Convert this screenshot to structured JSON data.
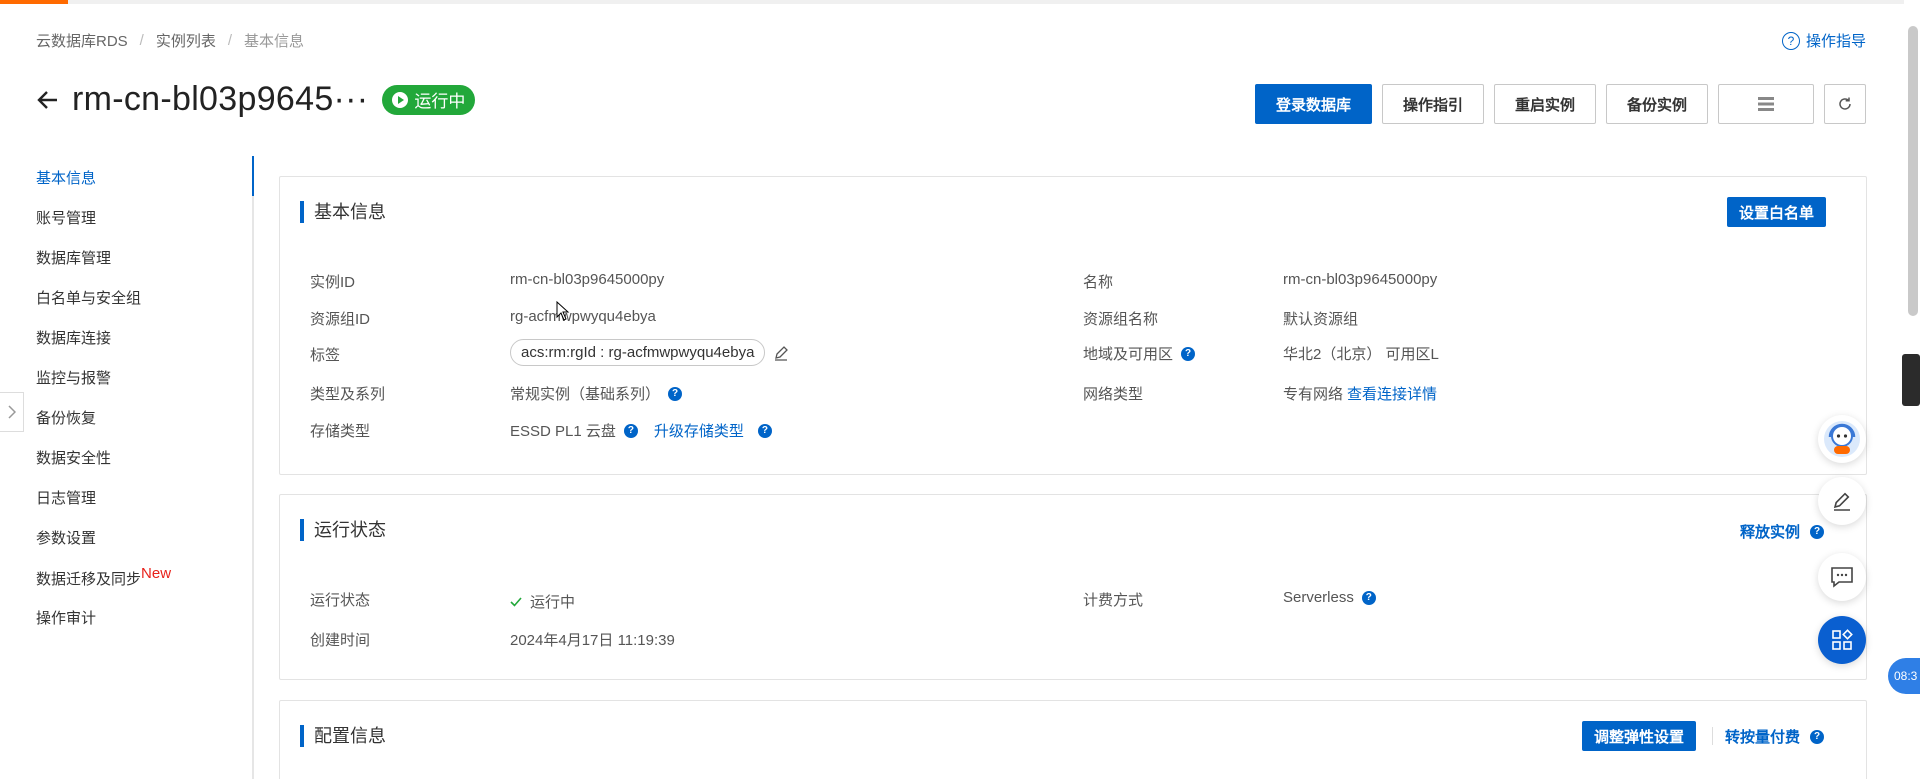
{
  "breadcrumb": [
    "云数据库RDS",
    "实例列表",
    "基本信息"
  ],
  "help_link": "操作指导",
  "title": "rm-cn-bl03p9645···",
  "status_badge": "运行中",
  "actions": {
    "login": "登录数据库",
    "guide": "操作指引",
    "restart": "重启实例",
    "backup": "备份实例"
  },
  "sidebar": {
    "items": [
      "基本信息",
      "账号管理",
      "数据库管理",
      "白名单与安全组",
      "数据库连接",
      "监控与报警",
      "备份恢复",
      "数据安全性",
      "日志管理",
      "参数设置",
      "数据迁移及同步",
      "操作审计"
    ],
    "new_badge": "New"
  },
  "basic_info": {
    "title": "基本信息",
    "whitelist_button": "设置白名单",
    "left": {
      "instance_id_label": "实例ID",
      "instance_id": "rm-cn-bl03p9645000py",
      "rg_id_label": "资源组ID",
      "rg_id": "rg-acfmwpwyqu4ebya",
      "tag_label": "标签",
      "tag": "acs:rm:rgId : rg-acfmwpwyqu4ebya",
      "type_label": "类型及系列",
      "type": "常规实例（基础系列）",
      "storage_label": "存储类型",
      "storage": "ESSD PL1 云盘",
      "upgrade_storage": "升级存储类型"
    },
    "right": {
      "name_label": "名称",
      "name": "rm-cn-bl03p9645000py",
      "rg_name_label": "资源组名称",
      "rg_name": "默认资源组",
      "region_label": "地域及可用区",
      "region": "华北2（北京） 可用区L",
      "network_label": "网络类型",
      "network": "专有网络",
      "network_link": "查看连接详情"
    }
  },
  "run_status": {
    "title": "运行状态",
    "release_link": "释放实例",
    "status_label": "运行状态",
    "status": "运行中",
    "created_label": "创建时间",
    "created": "2024年4月17日 11:19:39",
    "billing_label": "计费方式",
    "billing": "Serverless"
  },
  "config": {
    "title": "配置信息",
    "adjust_button": "调整弹性设置",
    "payg_link": "转按量付费"
  },
  "time_chip": "08:3",
  "colors": {
    "primary": "#0064c8",
    "running": "#22a83a",
    "new_badge": "#e8221b"
  }
}
